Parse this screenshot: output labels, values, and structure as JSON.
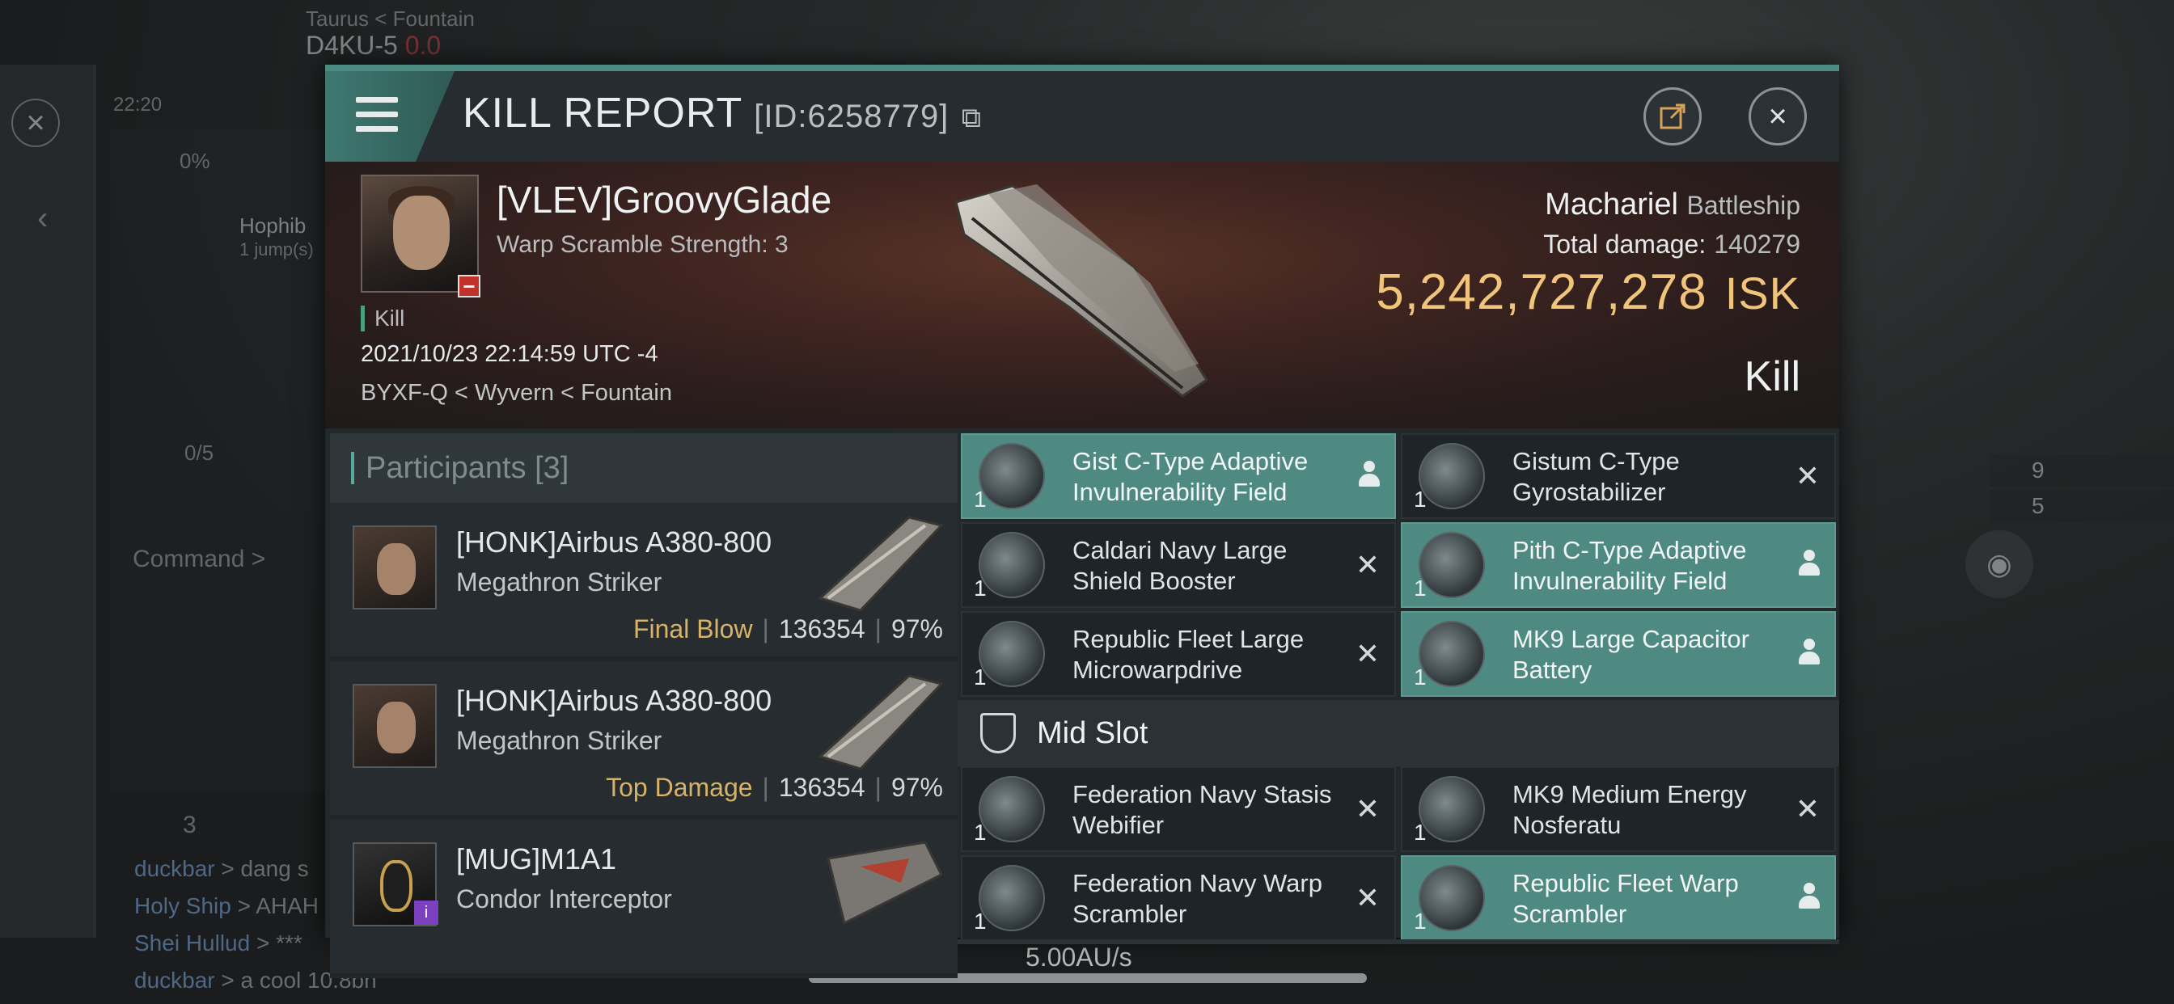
{
  "background": {
    "system_region": "Taurus < Fountain",
    "system_name": "D4KU-5",
    "security": "0.0",
    "time": "22:20",
    "cargo_percent": "0%",
    "route_name": "Hophib",
    "route_jumps": "1 jump(s)",
    "fleet_slots": "0/5",
    "command_label": "Command >",
    "member_count": "3",
    "speed": "5.00AU/s",
    "right_counts": [
      "9",
      "5"
    ],
    "chat": [
      {
        "who": "duckbar",
        "msg": "> dang s"
      },
      {
        "who": "Holy Ship",
        "msg": "> AHAH"
      },
      {
        "who": "Shei Hullud",
        "msg": "> ***"
      },
      {
        "who": "duckbar",
        "msg": "> a cool 10.8bn"
      }
    ]
  },
  "header": {
    "title": "KILL REPORT",
    "report_id": "[ID:6258779]"
  },
  "victim": {
    "name": "[VLEV]GroovyGlade",
    "scramble": "Warp Scramble Strength: 3",
    "kill_tag": "Kill",
    "datetime": "2021/10/23 22:14:59 UTC -4",
    "location": "BYXF-Q < Wyvern < Fountain",
    "ship": "Machariel",
    "ship_class": "Battleship",
    "total_damage_label": "Total damage:",
    "total_damage": "140279",
    "isk_value": "5,242,727,278",
    "isk_unit": "ISK",
    "result": "Kill"
  },
  "participants": {
    "label": "Participants",
    "count": "[3]",
    "rows": [
      {
        "name": "[HONK]Airbus A380-800",
        "ship": "Megathron Striker",
        "tag": "Final Blow",
        "damage": "136354",
        "percent": "97%"
      },
      {
        "name": "[HONK]Airbus A380-800",
        "ship": "Megathron Striker",
        "tag": "Top Damage",
        "damage": "136354",
        "percent": "97%"
      },
      {
        "name": "[MUG]M1A1",
        "ship": "Condor Interceptor",
        "tag": "",
        "damage": "",
        "percent": ""
      }
    ]
  },
  "fittings": {
    "low": [
      {
        "name": "Gist C-Type Adaptive Invulnerability Field",
        "qty": "1",
        "status": "dropped"
      },
      {
        "name": "Gistum C-Type Gyrostabilizer",
        "qty": "1",
        "status": "destroyed"
      },
      {
        "name": "Caldari Navy Large Shield Booster",
        "qty": "1",
        "status": "destroyed"
      },
      {
        "name": "Pith C-Type Adaptive Invulnerability Field",
        "qty": "1",
        "status": "dropped"
      },
      {
        "name": "Republic Fleet Large Microwarpdrive",
        "qty": "1",
        "status": "destroyed"
      },
      {
        "name": "MK9 Large Capacitor Battery",
        "qty": "1",
        "status": "dropped"
      }
    ],
    "mid_label": "Mid Slot",
    "mid": [
      {
        "name": "Federation Navy Stasis Webifier",
        "qty": "1",
        "status": "destroyed"
      },
      {
        "name": "MK9 Medium Energy Nosferatu",
        "qty": "1",
        "status": "destroyed"
      },
      {
        "name": "Federation Navy Warp Scrambler",
        "qty": "1",
        "status": "destroyed"
      },
      {
        "name": "Republic Fleet Warp Scrambler",
        "qty": "1",
        "status": "dropped"
      }
    ]
  },
  "colors": {
    "accent": "#4f8a82",
    "isk": "#f0c47a",
    "final_blow": "#d7b36a"
  }
}
